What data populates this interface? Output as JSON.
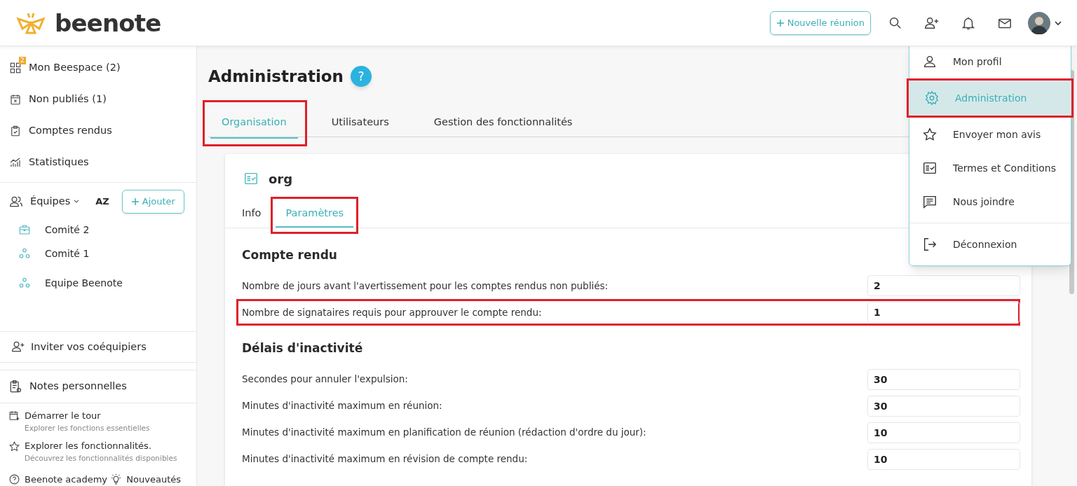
{
  "header": {
    "brand": "beenote",
    "new_meeting_button": "Nouvelle réunion"
  },
  "sidebar": {
    "nav": [
      {
        "label": "Mon Beespace (2)",
        "badge": "2"
      },
      {
        "label": "Non publiés (1)"
      },
      {
        "label": "Comptes rendus"
      },
      {
        "label": "Statistiques"
      }
    ],
    "teams_label": "Équipes",
    "sort_label": "AZ",
    "add_button": "Ajouter",
    "teams": [
      {
        "name": "Comité 2",
        "kind": "project"
      },
      {
        "name": "Comité 1",
        "kind": "team"
      },
      {
        "name": "Equipe Beenote",
        "kind": "team"
      }
    ],
    "invite": "Inviter vos coéquipiers",
    "notes": "Notes personnelles",
    "tour": [
      {
        "title": "Démarrer le tour",
        "subtitle": "Explorer les fonctions essentielles"
      },
      {
        "title": "Explorer les fonctionnalités.",
        "subtitle": "Découvrez les fonctionnalités disponibles"
      }
    ],
    "footer": [
      "Beenote academy",
      "Nouveautés"
    ]
  },
  "page": {
    "title": "Administration",
    "help": "?",
    "tabs": [
      {
        "label": "Organisation",
        "selected": true,
        "highlighted": true
      },
      {
        "label": "Utilisateurs",
        "selected": false,
        "highlighted": false
      },
      {
        "label": "Gestion des fonctionnalités",
        "selected": false,
        "highlighted": false
      }
    ],
    "org_name": "org",
    "subtabs": [
      {
        "label": "Info",
        "selected": false,
        "highlighted": false
      },
      {
        "label": "Paramètres",
        "selected": true,
        "highlighted": true
      }
    ],
    "sections": [
      {
        "title": "Compte rendu",
        "rows": [
          {
            "label": "Nombre de jours avant l'avertissement pour les comptes rendus non publiés:",
            "value": "2",
            "highlighted": false
          },
          {
            "label": "Nombre de signataires requis pour approuver le compte rendu:",
            "value": "1",
            "highlighted": true
          }
        ]
      },
      {
        "title": "Délais d'inactivité",
        "rows": [
          {
            "label": "Secondes pour annuler l'expulsion:",
            "value": "30",
            "highlighted": false
          },
          {
            "label": "Minutes d'inactivité maximum en réunion:",
            "value": "30",
            "highlighted": false
          },
          {
            "label": "Minutes d'inactivité maximum en planification de réunion (rédaction d'ordre du jour):",
            "value": "10",
            "highlighted": false
          },
          {
            "label": "Minutes d'inactivité maximum en révision de compte rendu:",
            "value": "10",
            "highlighted": false
          }
        ]
      }
    ]
  },
  "user_menu": {
    "items": [
      {
        "label": "Mon profil",
        "selected": false,
        "highlighted": false
      },
      {
        "label": "Administration",
        "selected": true,
        "highlighted": true
      },
      {
        "label": "Envoyer mon avis",
        "selected": false,
        "highlighted": false
      },
      {
        "label": "Termes et Conditions",
        "selected": false,
        "highlighted": false
      },
      {
        "label": "Nous joindre",
        "selected": false,
        "highlighted": false
      },
      {
        "label": "Déconnexion",
        "selected": false,
        "highlighted": false,
        "divider_before": true
      }
    ]
  }
}
